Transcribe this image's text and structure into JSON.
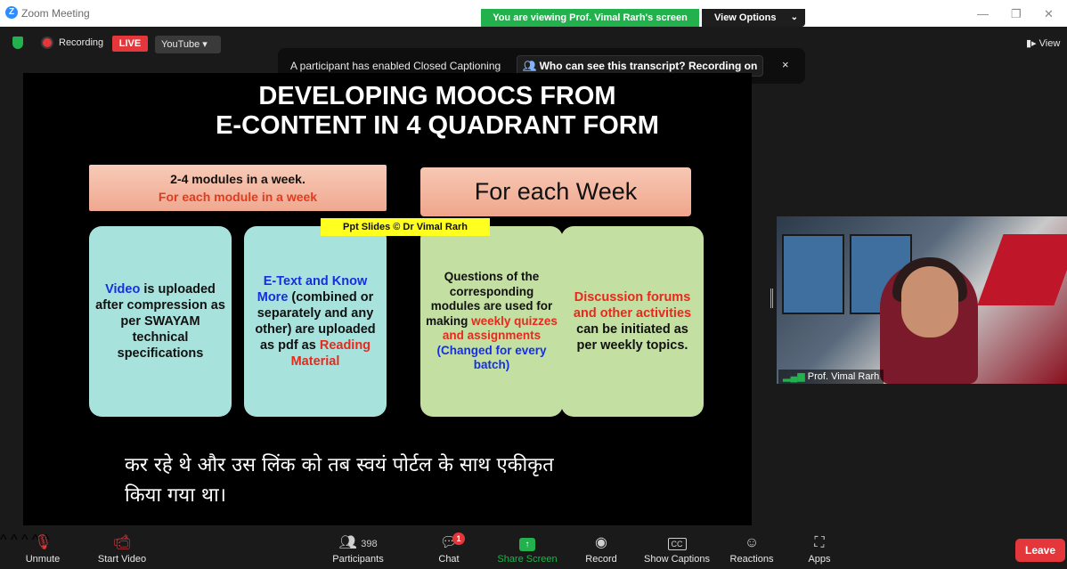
{
  "window": {
    "title": "Zoom Meeting",
    "app_icon": "Z",
    "minimize": "—",
    "restore": "❐",
    "close": "✕"
  },
  "share_banner": {
    "text": "You are viewing Prof. Vimal Rarh's screen",
    "view_options_label": "View Options",
    "color": "#22b14c"
  },
  "status": {
    "recording_label": "Recording",
    "live_label": "LIVE",
    "stream_label": "YouTube ▾"
  },
  "view_button": "View",
  "cc_notice": {
    "message": "A participant has enabled Closed Captioning",
    "who_label": "Who can see this transcript? Recording on",
    "close": "×"
  },
  "slide": {
    "title_line1": "DEVELOPING MOOCS FROM",
    "title_line2": "E-CONTENT IN 4 QUADRANT FORM",
    "top_left_line1": "2-4 modules in a week.",
    "top_left_line2": "For each module in a week",
    "top_right": "For each Week",
    "credit": "Ppt Slides © Dr Vimal Rarh",
    "card1": {
      "lead": "Video",
      "rest": " is uploaded after compression as per SWAYAM technical specifications"
    },
    "card2": {
      "lead": "E-Text and Know More",
      "middle": " (combined or separately and any other) are uploaded as pdf as ",
      "tail": "Reading Material"
    },
    "card3": {
      "lead": "Questions of the corresponding modules are used for making ",
      "red": "weekly quizzes and assignments",
      "blue": " (Changed for every batch)"
    },
    "card4": {
      "red": "Discussion forums and other activities",
      "rest": " can be initiated as per weekly topics."
    }
  },
  "caption": {
    "line1": "कर रहे थे और उस लिंक को तब स्वयं पोर्टल के साथ एकीकृत",
    "line2": "किया गया था।"
  },
  "video_tile": {
    "name": "Prof. Vimal Rarh"
  },
  "toolbar": {
    "unmute": "Unmute",
    "start_video": "Start Video",
    "participants": "Participants",
    "participants_count": "398",
    "chat": "Chat",
    "chat_badge": "1",
    "share_screen": "Share Screen",
    "record": "Record",
    "show_captions": "Show Captions",
    "cc_glyph": "CC",
    "reactions": "Reactions",
    "apps": "Apps",
    "leave": "Leave"
  },
  "colors": {
    "accent_green": "#22b14c",
    "danger_red": "#e3373c",
    "zoom_blue": "#2d8cff"
  }
}
